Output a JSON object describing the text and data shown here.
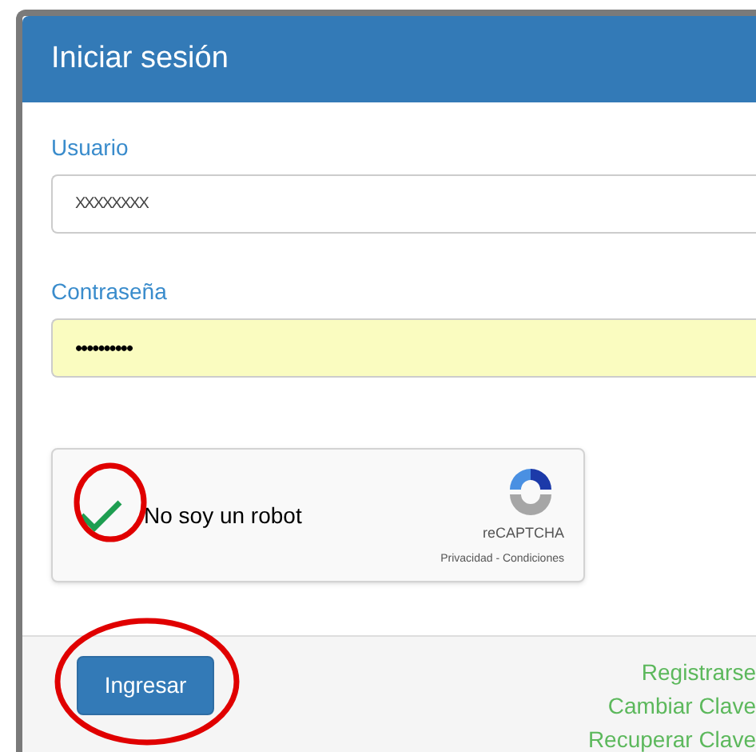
{
  "panel": {
    "title": "Iniciar sesión"
  },
  "fields": [
    {
      "label": "Usuario",
      "value": "XXXXXXXX",
      "autofilled": false
    },
    {
      "label": "Contraseña",
      "value": "••••••••••",
      "autofilled": true
    }
  ],
  "captcha": {
    "checked": true,
    "label": "No soy un robot",
    "brand": "reCAPTCHA",
    "links": "Privacidad - Condiciones"
  },
  "submit": "Ingresar",
  "links": [
    "Registrarse",
    "Cambiar Clave",
    "Recuperar Clave"
  ]
}
